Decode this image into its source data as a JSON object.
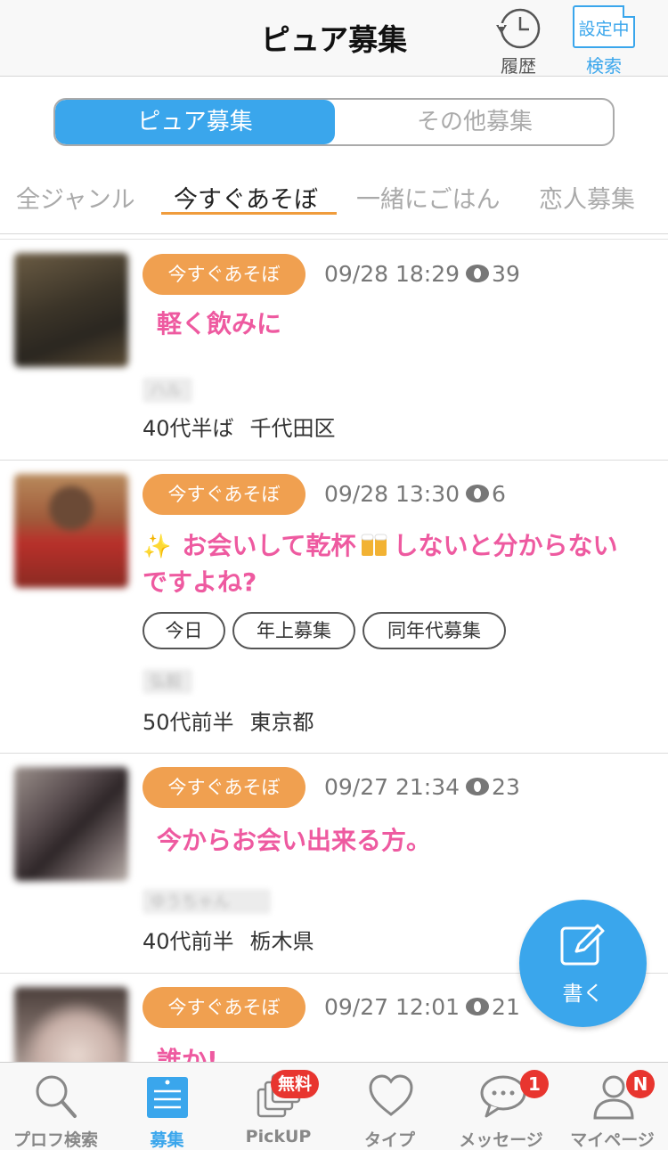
{
  "header": {
    "title": "ピュア募集",
    "history_label": "履歴",
    "search_status": "設定中",
    "search_label": "検索"
  },
  "segment": {
    "items": [
      "ピュア募集",
      "その他募集"
    ],
    "selected": "ピュア募集"
  },
  "genres": {
    "items": [
      "全ジャンル",
      "今すぐあそぼ",
      "一緒にごはん",
      "恋人募集"
    ],
    "selected": "今すぐあそぼ"
  },
  "posts": [
    {
      "tag": "今すぐあそぼ",
      "datetime": "09/28 18:29",
      "views": "39",
      "title": "軽く飲みに",
      "nickname": "ハル",
      "age": "40代半ば",
      "location": "千代田区",
      "avatar_colors": [
        "#3b3428",
        "#5a4b34"
      ]
    },
    {
      "tag": "今すぐあそぼ",
      "datetime": "09/28 13:30",
      "views": "6",
      "title_part1": "お会いして乾杯",
      "title_part2": "しないと分からないですよね?",
      "chips": [
        "今日",
        "年上募集",
        "同年代募集"
      ],
      "nickname": "弘毅",
      "age": "50代前半",
      "location": "東京都",
      "avatar_colors": [
        "#8a2a22",
        "#c04a36"
      ]
    },
    {
      "tag": "今すぐあそぼ",
      "datetime": "09/27 21:34",
      "views": "23",
      "title": "今からお会い出来る方。",
      "nickname": "ゆうちゃん",
      "age": "40代前半",
      "location": "栃木県",
      "avatar_colors": [
        "#3a3236",
        "#7a6e6e"
      ]
    },
    {
      "tag": "今すぐあそぼ",
      "datetime": "09/27 12:01",
      "views": "21",
      "title": "誰か!",
      "avatar_colors": [
        "#d8c8c0",
        "#6e625c"
      ]
    }
  ],
  "fab": {
    "label": "書く"
  },
  "bottom_nav": {
    "items": [
      {
        "label": "プロフ検索",
        "icon": "search-icon"
      },
      {
        "label": "募集",
        "icon": "list-icon"
      },
      {
        "label": "PickUP",
        "icon": "cards-icon",
        "badge": "無料"
      },
      {
        "label": "タイプ",
        "icon": "heart-icon"
      },
      {
        "label": "メッセージ",
        "icon": "chat-icon",
        "badge": "1"
      },
      {
        "label": "マイページ",
        "icon": "person-icon",
        "badge": "N"
      }
    ],
    "selected": "募集"
  },
  "colors": {
    "accent_blue": "#3aa6ec",
    "tag_orange": "#f0a050",
    "title_pink": "#ee5aa0",
    "badge_red": "#e8352f",
    "underline_orange": "#f09c3c"
  }
}
